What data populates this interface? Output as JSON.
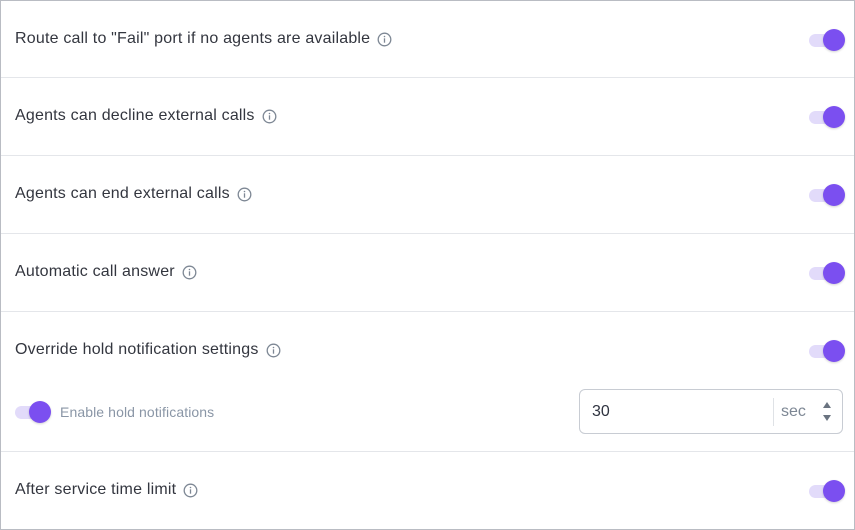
{
  "colors": {
    "accent": "#7b4ff0",
    "toggle_track": "#e2dbfa",
    "text": "#33363f",
    "muted_text": "#8a96a6",
    "divider": "#e4e6ea"
  },
  "settings": [
    {
      "label": "Route call to \"Fail\" port if no agents are available",
      "icon": "info-icon",
      "enabled": true
    },
    {
      "label": "Agents can decline external calls",
      "icon": "info-icon",
      "enabled": true
    },
    {
      "label": "Agents can end external calls",
      "icon": "info-icon",
      "enabled": true
    },
    {
      "label": "Automatic call answer",
      "icon": "info-icon",
      "enabled": true
    },
    {
      "label": "Override hold notification settings",
      "icon": "info-icon",
      "enabled": true
    },
    {
      "label": "After service time limit",
      "icon": "info-icon",
      "enabled": true
    }
  ],
  "hold_notifications": {
    "label": "Enable hold notifications",
    "enabled": true,
    "interval_value": "30",
    "interval_unit": "sec"
  }
}
